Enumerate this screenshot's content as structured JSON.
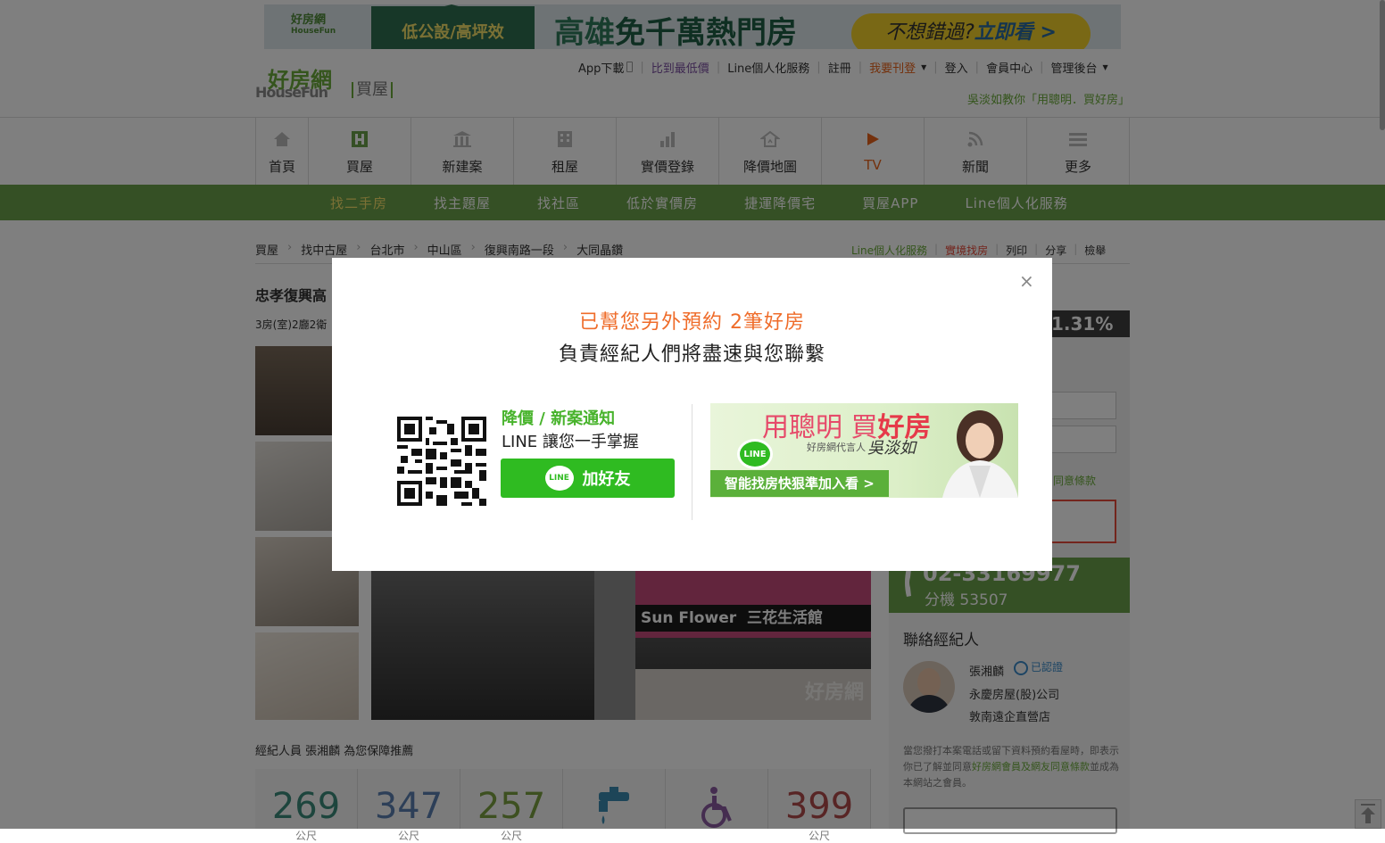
{
  "banner": {
    "logo_zh": "好房網",
    "logo_en": "HouseFun",
    "tag": "低公設/高坪效",
    "headline_a": "高雄",
    "headline_b": "免千萬熱門房",
    "cta_a": "不想錯過?",
    "cta_b": "立即看 >"
  },
  "logo": {
    "zh": "好房網",
    "en": "HouseFun",
    "section": "買屋"
  },
  "topnav": {
    "app": "App下載",
    "compare": "比到最低價",
    "line": "Line個人化服務",
    "register": "註冊",
    "post": "我要刊登",
    "login": "登入",
    "member": "會員中心",
    "admin": "管理後台"
  },
  "slogan": "吳淡如教你「用聰明．買好房」",
  "mainnav": [
    {
      "label": "首頁",
      "icon": "home-icon"
    },
    {
      "label": "買屋",
      "icon": "buy-house-icon"
    },
    {
      "label": "新建案",
      "icon": "building-icon"
    },
    {
      "label": "租屋",
      "icon": "apartment-icon"
    },
    {
      "label": "實價登錄",
      "icon": "bar-chart-icon"
    },
    {
      "label": "降價地圖",
      "icon": "map-house-icon"
    },
    {
      "label": "TV",
      "icon": "play-icon"
    },
    {
      "label": "新聞",
      "icon": "rss-icon"
    },
    {
      "label": "更多",
      "icon": "menu-icon"
    }
  ],
  "subnav": [
    "找二手房",
    "找主題屋",
    "找社區",
    "低於實價房",
    "捷運降價宅",
    "買屋APP",
    "Line個人化服務"
  ],
  "breadcrumb": [
    "買屋",
    "找中古屋",
    "台北市",
    "中山區",
    "復興南路一段",
    "大同晶鑽"
  ],
  "tools": {
    "line": "Line個人化服務",
    "price": "實境找房",
    "print": "列印",
    "share": "分享",
    "report": "檢舉"
  },
  "listing": {
    "title": "忠孝復興高",
    "sub": "3房(室)2廳2衛",
    "price_change": "1.31%"
  },
  "agree_text": "同意條款",
  "phone": {
    "number": "02-33169977",
    "ext": "分機 53507"
  },
  "agent": {
    "heading": "聯絡經紀人",
    "name": "張湘麟",
    "verified": "已認證",
    "company": "永慶房屋(股)公司",
    "branch": "敦南遠企直營店",
    "disclaimer_a": "當您撥打本案電話或留下資料預約看屋時，即表示你已了解並同意",
    "disclaimer_link": "好房網會員及網友同意條款",
    "disclaimer_b": "並成為本網站之會員。"
  },
  "recommend": "經紀人員 張湘麟 為您保障推薦",
  "stats": [
    {
      "n": "269",
      "u": "公尺",
      "color": "#3b8b7a"
    },
    {
      "n": "347",
      "u": "公尺",
      "color": "#5a7fb0"
    },
    {
      "n": "257",
      "u": "公尺",
      "color": "#7aa040"
    },
    {
      "n": "",
      "u": "",
      "color": "#3b8bb0",
      "icon": "water-tap-icon"
    },
    {
      "n": "",
      "u": "",
      "color": "#8a5aa0",
      "icon": "wheelchair-icon"
    },
    {
      "n": "399",
      "u": "公尺",
      "color": "#b04a4a"
    }
  ],
  "photo": {
    "sign_a": "Sun Flower",
    "sign_b": "三花生活館",
    "watermark": "好房網"
  },
  "modal": {
    "close": "×",
    "line1": "已幫您另外預約 2筆好房",
    "line2": "負責經紀人們將盡速與您聯繫",
    "line_head": "降價 / 新案通知",
    "line_sub": "LINE 讓您一手掌握",
    "line_btn": "加好友",
    "line_logo": "LINE",
    "ad_title_a": "用聰明 買",
    "ad_title_b": "好房",
    "ad_spokes": "好房網代言人",
    "ad_sign": "吳淡如",
    "ad_bar": "智能找房快狠準加入看 >",
    "ad_logo": "LINE"
  }
}
